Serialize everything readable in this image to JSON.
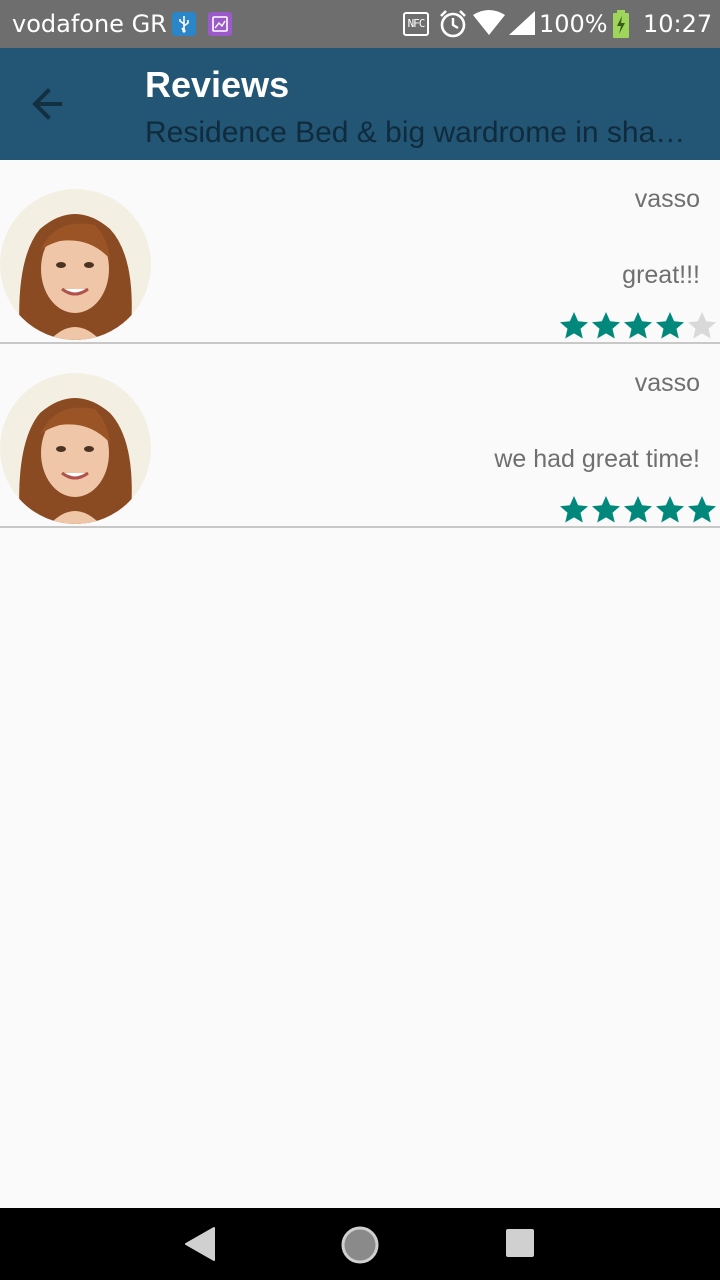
{
  "status_bar": {
    "carrier": "vodafone GR",
    "nfc_label": "NFC",
    "battery": "100%",
    "time": "10:27",
    "icons": [
      "usb-debug-icon",
      "gallery-icon",
      "nfc-icon",
      "alarm-icon",
      "wifi-icon",
      "signal-icon",
      "battery-charging-icon"
    ]
  },
  "toolbar": {
    "title": "Reviews",
    "subtitle": "Residence Bed & big wardrome in sha…",
    "back_icon": "arrow-back-icon",
    "color": "#225674"
  },
  "reviews": [
    {
      "name": "vasso",
      "comment": "great!!!",
      "rating": 4,
      "max_rating": 5
    },
    {
      "name": "vasso",
      "comment": "we had great time!",
      "rating": 5,
      "max_rating": 5
    }
  ],
  "colors": {
    "star_filled": "#00897b",
    "star_empty": "#d9d9d9",
    "divider": "#c8c8c8"
  },
  "nav_bar": {
    "icons": [
      "nav-back-icon",
      "nav-home-icon",
      "nav-recents-icon"
    ]
  }
}
